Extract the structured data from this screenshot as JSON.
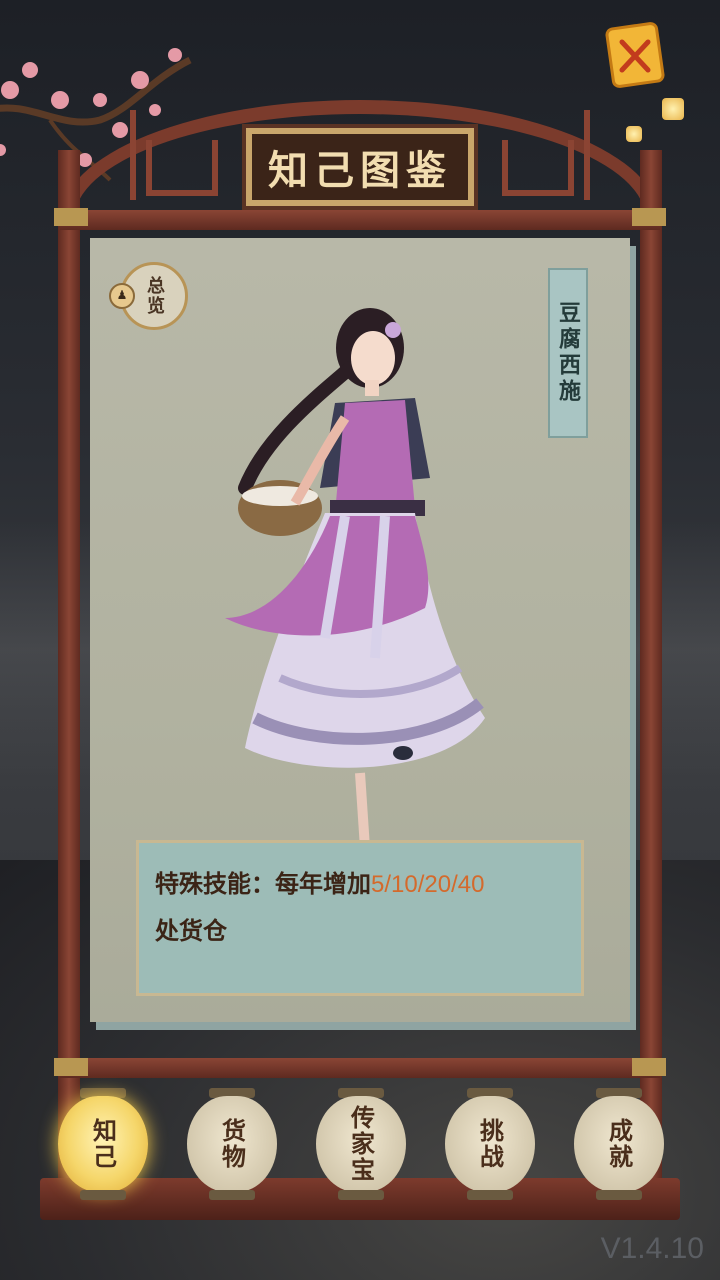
{
  "header": {
    "title": "知己图鉴"
  },
  "overview_button": {
    "label": "总览",
    "icon": "person-icon"
  },
  "close_button": {
    "icon": "close-lantern-icon"
  },
  "character": {
    "name": "豆腐西施",
    "skill_label": "特殊技能：每年增加",
    "skill_values": "5/10/20/40",
    "skill_suffix": "处货仓"
  },
  "tabs": [
    {
      "label": "知己",
      "active": true
    },
    {
      "label": "货物",
      "active": false
    },
    {
      "label": "传家宝",
      "active": false
    },
    {
      "label": "挑战",
      "active": false
    },
    {
      "label": "成就",
      "active": false
    }
  ],
  "version": "V1.4.10",
  "colors": {
    "frame": "#7b3b2c",
    "skill_highlight": "#d46a2c",
    "active_lantern": "#f5d66a"
  }
}
